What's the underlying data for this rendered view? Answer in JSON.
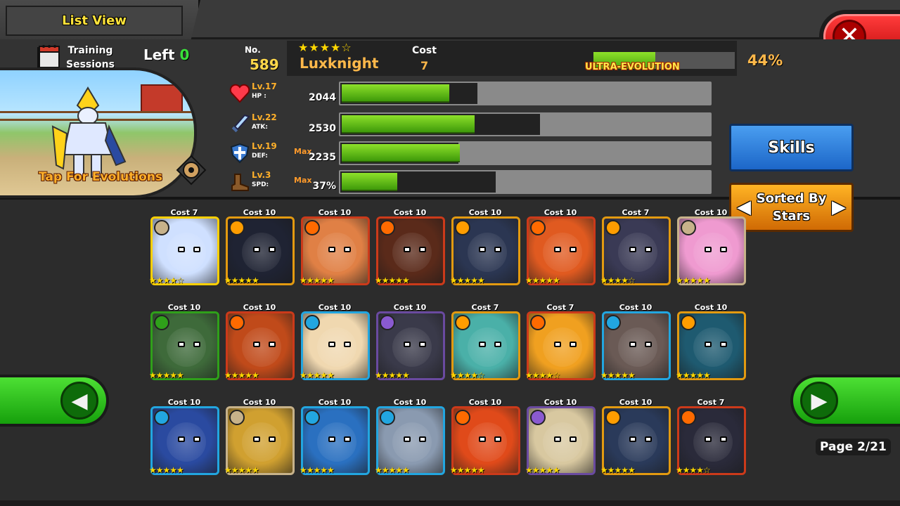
{
  "header": {
    "tab_label": "List View"
  },
  "training": {
    "line1": "Training",
    "line2": "Sessions",
    "left_label": "Left",
    "left_value": "0"
  },
  "art": {
    "tap_label": "Tap For Evolutions"
  },
  "monster": {
    "no_label": "No.",
    "no_value": "589",
    "stars": "★★★★☆",
    "name": "Luxknight",
    "cost_label": "Cost",
    "cost_value": "7",
    "evolution_label": "ULTRA-EVOLUTION",
    "evolution_percent": "44%",
    "evolution_fraction": 0.44
  },
  "stats": [
    {
      "lv": "Lv.17",
      "name": "HP :",
      "max": "",
      "value": "2044",
      "cap": 0.37,
      "fill": 0.29,
      "icon": "heart-icon"
    },
    {
      "lv": "Lv.22",
      "name": "ATK:",
      "max": "",
      "value": "2530",
      "cap": 0.54,
      "fill": 0.36,
      "icon": "sword-icon"
    },
    {
      "lv": "Lv.19",
      "name": "DEF:",
      "max": "Max",
      "value": "2235",
      "cap": 0.32,
      "fill": 0.32,
      "icon": "shield-icon"
    },
    {
      "lv": "Lv.3",
      "name": "SPD:",
      "max": "Max",
      "value": "37%",
      "cap": 0.42,
      "fill": 0.15,
      "icon": "boot-icon"
    }
  ],
  "buttons": {
    "skills": "Skills",
    "sort_line1": "Sorted By",
    "sort_line2": "Stars",
    "close_glyph": "✕"
  },
  "cards": [
    [
      {
        "cost": "Cost 7",
        "stars": "★★★★☆",
        "element": "#c7b28a",
        "bg": "#cfe0ff",
        "frame": "#ffd000"
      },
      {
        "cost": "Cost 10",
        "stars": "★★★★★",
        "element": "#ff9d00",
        "bg": "#1f2333",
        "frame": "#e39a10"
      },
      {
        "cost": "Cost 10",
        "stars": "★★★★★",
        "element": "#ff6a00",
        "bg": "#e08045",
        "frame": "#cc3a1a"
      },
      {
        "cost": "Cost 10",
        "stars": "★★★★★",
        "element": "#ff6a00",
        "bg": "#5a2a1a",
        "frame": "#cc3a1a"
      },
      {
        "cost": "Cost 10",
        "stars": "★★★★★",
        "element": "#ff9d00",
        "bg": "#2b3652",
        "frame": "#e39a10"
      },
      {
        "cost": "Cost 10",
        "stars": "★★★★★",
        "element": "#ff6a00",
        "bg": "#e05a20",
        "frame": "#cc3a1a"
      },
      {
        "cost": "Cost 7",
        "stars": "★★★★☆",
        "element": "#ff9d00",
        "bg": "#3a3a55",
        "frame": "#e39a10"
      },
      {
        "cost": "Cost 10",
        "stars": "★★★★★",
        "element": "#c7b28a",
        "bg": "#ef9ad0",
        "frame": "#c7b28a"
      }
    ],
    [
      {
        "cost": "Cost 10",
        "stars": "★★★★★",
        "element": "#2fa01a",
        "bg": "#3e6a3a",
        "frame": "#2fa01a"
      },
      {
        "cost": "Cost 10",
        "stars": "★★★★★",
        "element": "#ff6a00",
        "bg": "#c04a1a",
        "frame": "#cc3a1a"
      },
      {
        "cost": "Cost 10",
        "stars": "★★★★★",
        "element": "#22a6e0",
        "bg": "#f0d8b0",
        "frame": "#22a6e0"
      },
      {
        "cost": "Cost 10",
        "stars": "★★★★★",
        "element": "#8a5ad0",
        "bg": "#3a3a4a",
        "frame": "#6a4aa0"
      },
      {
        "cost": "Cost 7",
        "stars": "★★★★☆",
        "element": "#ff9d00",
        "bg": "#4ab0a8",
        "frame": "#e39a10"
      },
      {
        "cost": "Cost 7",
        "stars": "★★★★☆",
        "element": "#ff6a00",
        "bg": "#f0a020",
        "frame": "#cc3a1a"
      },
      {
        "cost": "Cost 10",
        "stars": "★★★★★",
        "element": "#22a6e0",
        "bg": "#6a5a55",
        "frame": "#22a6e0"
      },
      {
        "cost": "Cost 10",
        "stars": "★★★★★",
        "element": "#ff9d00",
        "bg": "#1e5a70",
        "frame": "#e39a10"
      }
    ],
    [
      {
        "cost": "Cost 10",
        "stars": "★★★★★",
        "element": "#22a6e0",
        "bg": "#2a4aa0",
        "frame": "#22a6e0"
      },
      {
        "cost": "Cost 10",
        "stars": "★★★★★",
        "element": "#c7b28a",
        "bg": "#d0a030",
        "frame": "#c7b28a"
      },
      {
        "cost": "Cost 10",
        "stars": "★★★★★",
        "element": "#22a6e0",
        "bg": "#2a70c0",
        "frame": "#22a6e0"
      },
      {
        "cost": "Cost 10",
        "stars": "★★★★★",
        "element": "#22a6e0",
        "bg": "#8a9ab0",
        "frame": "#22a6e0"
      },
      {
        "cost": "Cost 10",
        "stars": "★★★★★",
        "element": "#ff6a00",
        "bg": "#e04a1a",
        "frame": "#cc3a1a"
      },
      {
        "cost": "Cost 10",
        "stars": "★★★★★",
        "element": "#8a5ad0",
        "bg": "#d8c8a0",
        "frame": "#6a4aa0"
      },
      {
        "cost": "Cost 10",
        "stars": "★★★★★",
        "element": "#ff9d00",
        "bg": "#2a3a5a",
        "frame": "#e39a10"
      },
      {
        "cost": "Cost 7",
        "stars": "★★★★☆",
        "element": "#ff6a00",
        "bg": "#2a2a3a",
        "frame": "#cc3a1a"
      }
    ]
  ],
  "nav": {
    "prev_glyph": "◀",
    "next_glyph": "▶"
  },
  "page": {
    "label": "Page 2/21"
  }
}
